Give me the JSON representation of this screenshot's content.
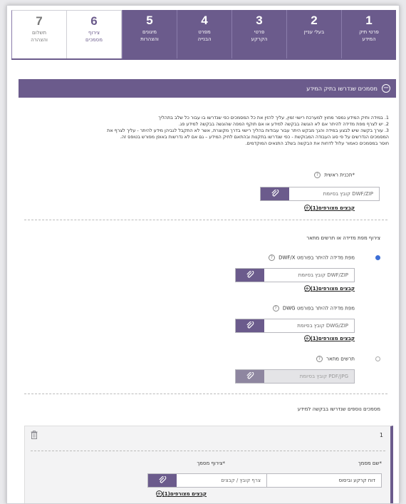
{
  "tabs": [
    {
      "num": "1",
      "label": "פרטי תיק\nהמידע"
    },
    {
      "num": "2",
      "label": "בעלי עניין"
    },
    {
      "num": "3",
      "label": "פרטי\nהקרקע"
    },
    {
      "num": "4",
      "label": "מפרט\nהבנייה"
    },
    {
      "num": "5",
      "label": "מיגונים\nוהצהרות"
    },
    {
      "num": "6",
      "label": "צירוף\nמסמכים"
    },
    {
      "num": "7",
      "label": "תשלום\nוהצהרה"
    }
  ],
  "section": {
    "title": "מסמכים שנדרשו בתיק המידע"
  },
  "notes": [
    "1. במידה ותיק המידע נמסר מחוץ למערכת רישוי זמין, עליך להזין את כל המסמכים כפי שנדרשו בו עבור כל שלב בתהליך",
    "2. יש לצרף מפת מדידה להיתר אם לא הוגשה בבקשה למידע או אם תוקף המפה שהוגשה בבקשה למידע פג.",
    "3. עורך בקשה שיש לבצע במידה והגך מבקש היתר עבור עבודות בהליך רישוי בדרך מקוצרת, אשר לא התקבל לגביהן מידע להיתר - עליך לצרף את",
    "המסמכים הנדרשים על פי סוג העבודה המבוקשת - כפי שנדרשו בתקנות ובהתאם לתיק המידע – גם אם לא נדרשות באופן מפורש בטופס זה.",
    "חוסר במסמכים כאמור עלול לדחות את הבקשה בשלב התנאים המוקדמים."
  ],
  "main_plan": {
    "label": "*תכנית ראשית",
    "placeholder": "DWF/ZIP קובץ בסיומת",
    "attached": "קבצים מצורפים(1)"
  },
  "survey": {
    "title": "צירוף מפת מדידה או תרשים מתאר",
    "dwfx": {
      "label": "מפת מדידה להיתר בפורמט DWF/X",
      "placeholder": "DWF/ZIP קובץ בסיומת",
      "attached": "קבצים מצורפים(1)"
    },
    "dwg": {
      "label": "מפת מדידה להיתר בפורמט DWG",
      "placeholder": "DWG/ZIP קובץ בסיומת",
      "attached": "קבצים מצורפים(1)"
    },
    "outline": {
      "label": "תרשים מתאר",
      "placeholder": "PDF/JPG קובץ בסיומת"
    }
  },
  "additional": {
    "title": "מסמכים נוספים שנדרשו בבקשה למידע",
    "item_number": "1",
    "doc_name_label": "*שם מסמך",
    "doc_name_value": "דוח קרקע וביסוס",
    "attach_label": "*צירוף מסמך",
    "attach_placeholder": "צרף קובץ / קבצים",
    "attached": "קבצים מצורפים(1)"
  },
  "colors": {
    "primary": "#6b5b8c",
    "radio_selected": "#3d6fd6"
  }
}
